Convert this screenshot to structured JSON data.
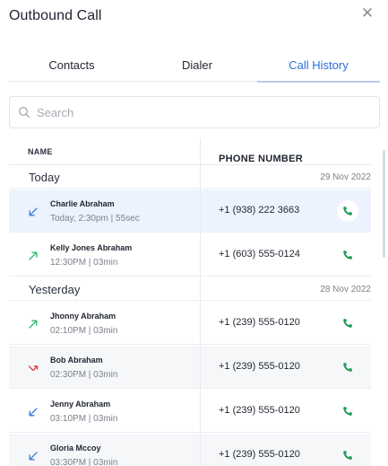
{
  "dialog": {
    "title": "Outbound Call"
  },
  "tabs": [
    {
      "label": "Contacts"
    },
    {
      "label": "Dialer"
    },
    {
      "label": "Call History",
      "active": true
    }
  ],
  "search": {
    "placeholder": "Search",
    "value": ""
  },
  "table": {
    "headers": {
      "name": "NAME",
      "phone": "PHONE NUMBER"
    },
    "groups": [
      {
        "label": "Today",
        "date": "29 Nov  2022"
      },
      {
        "label": "Yesterday",
        "date": "28 Nov  2022"
      }
    ],
    "rows": [
      {
        "name": "Charlie Abraham",
        "meta": "Today, 2:30pm | 55sec",
        "phone": "+1 (938) 222 3663",
        "direction": "incoming",
        "selected": true
      },
      {
        "name": "Kelly Jones Abraham",
        "meta": "12:30PM | 03min",
        "phone": "+1 (603) 555-0124",
        "direction": "outgoing"
      },
      {
        "name": "Jhonny Abraham",
        "meta": "02:10PM | 03min",
        "phone": "+1 (239) 555-0120",
        "direction": "outgoing"
      },
      {
        "name": "Bob Abraham",
        "meta": "02:30PM | 03min",
        "phone": "+1 (239) 555-0120",
        "direction": "missed"
      },
      {
        "name": "Jenny Abraham",
        "meta": "03:10PM | 03min",
        "phone": "+1 (239) 555-0120",
        "direction": "incoming"
      },
      {
        "name": "Gloria Mccoy",
        "meta": "03:30PM | 03min",
        "phone": "+1 (239) 555-0120",
        "direction": "incoming"
      }
    ]
  },
  "colors": {
    "accent": "#2e6fdb",
    "incoming": "#3b7be0",
    "outgoing": "#2fb66e",
    "missed": "#e0443e",
    "call_icon": "#1f9a57"
  },
  "icons": {
    "close": "close-icon",
    "search": "search-icon",
    "incoming": "incoming-call-arrow-icon",
    "outgoing": "outgoing-call-arrow-icon",
    "missed": "missed-call-arrow-icon",
    "call": "phone-icon"
  }
}
